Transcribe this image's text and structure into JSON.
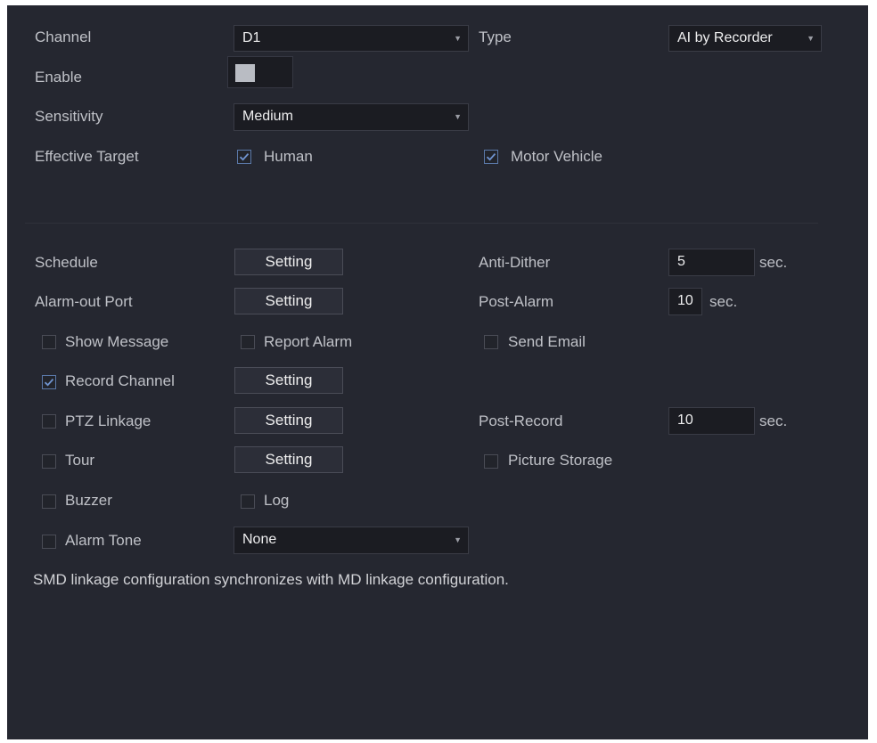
{
  "channel": {
    "label": "Channel",
    "value": "D1"
  },
  "type": {
    "label": "Type",
    "value": "AI by Recorder"
  },
  "enable": {
    "label": "Enable",
    "on": true
  },
  "sensitivity": {
    "label": "Sensitivity",
    "value": "Medium"
  },
  "effective_target": {
    "label": "Effective Target",
    "human": {
      "label": "Human",
      "checked": true
    },
    "motor_vehicle": {
      "label": "Motor Vehicle",
      "checked": true
    }
  },
  "schedule": {
    "label": "Schedule",
    "button": "Setting"
  },
  "anti_dither": {
    "label": "Anti-Dither",
    "value": "5",
    "unit": "sec."
  },
  "alarm_out_port": {
    "label": "Alarm-out Port",
    "button": "Setting"
  },
  "post_alarm": {
    "label": "Post-Alarm",
    "value": "10",
    "unit": "sec."
  },
  "show_message": {
    "label": "Show Message",
    "checked": false
  },
  "report_alarm": {
    "label": "Report Alarm",
    "checked": false
  },
  "send_email": {
    "label": "Send Email",
    "checked": false
  },
  "record_channel": {
    "label": "Record Channel",
    "checked": true,
    "button": "Setting"
  },
  "ptz_linkage": {
    "label": "PTZ Linkage",
    "checked": false,
    "button": "Setting"
  },
  "post_record": {
    "label": "Post-Record",
    "value": "10",
    "unit": "sec."
  },
  "tour": {
    "label": "Tour",
    "checked": false,
    "button": "Setting"
  },
  "picture_storage": {
    "label": "Picture Storage",
    "checked": false
  },
  "buzzer": {
    "label": "Buzzer",
    "checked": false
  },
  "log": {
    "label": "Log",
    "checked": false
  },
  "alarm_tone": {
    "label": "Alarm Tone",
    "checked": false,
    "value": "None"
  },
  "note": "SMD linkage configuration synchronizes with MD linkage configuration.",
  "icons": {
    "dropdown": "chevron-down-icon",
    "check": "checkmark-icon"
  },
  "colors": {
    "panel": "#252730",
    "field": "#1b1c22",
    "check": "#6f93cf"
  }
}
